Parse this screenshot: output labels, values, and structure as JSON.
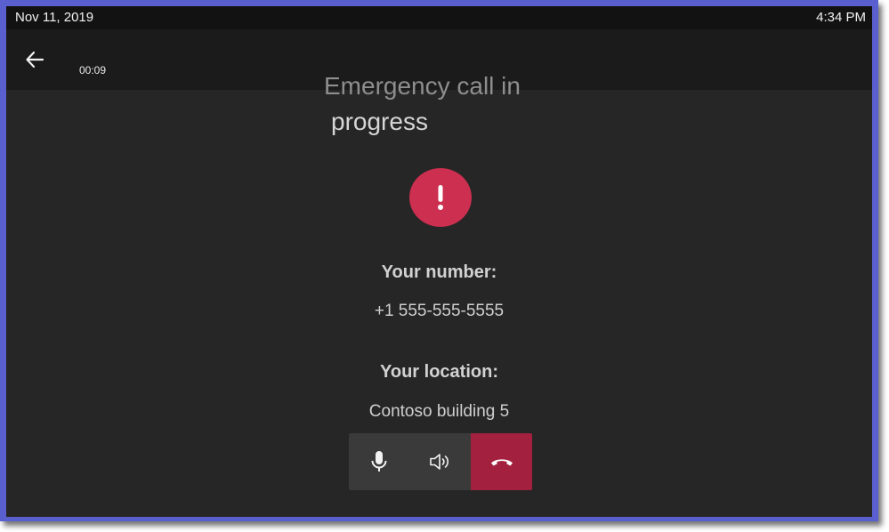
{
  "status_bar": {
    "date": "Nov 11, 2019",
    "time": "4:34 PM"
  },
  "header": {
    "timer": "00:09",
    "back_icon": "arrow-left-icon"
  },
  "title": {
    "line1": "Emergency call in",
    "line2": "progress"
  },
  "alert": {
    "icon": "exclamation-icon",
    "color": "#cc2f4f"
  },
  "details": {
    "number_label": "Your number:",
    "number_value": "+1 555-555-5555",
    "location_label": "Your location:",
    "location_value": "Contoso building 5"
  },
  "controls": {
    "mic_icon": "microphone-icon",
    "speaker_icon": "speaker-icon",
    "end_call_icon": "hang-up-icon",
    "end_call_color": "#a3213f"
  }
}
